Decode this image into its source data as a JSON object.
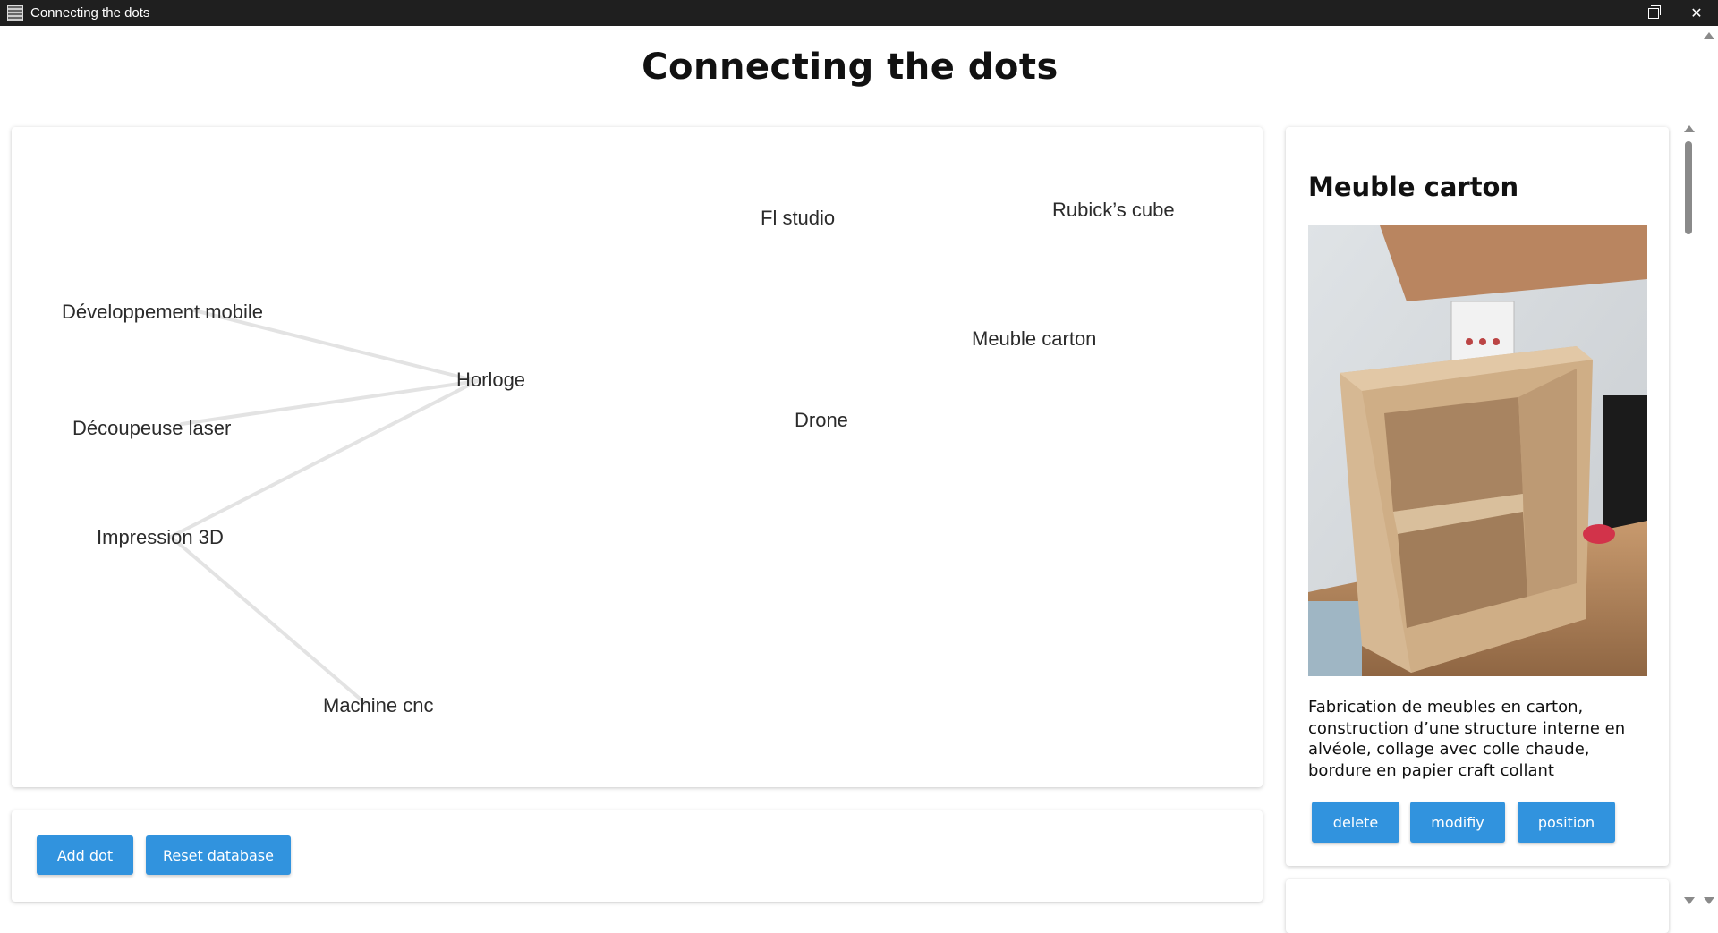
{
  "window": {
    "title": "Connecting the dots"
  },
  "page": {
    "title": "Connecting the dots"
  },
  "graph": {
    "nodes": [
      {
        "id": "fl",
        "label": "Fl studio"
      },
      {
        "id": "rubick",
        "label": "Rubick’s cube"
      },
      {
        "id": "devmobile",
        "label": "Développement mobile"
      },
      {
        "id": "meuble",
        "label": "Meuble carton"
      },
      {
        "id": "horloge",
        "label": "Horloge"
      },
      {
        "id": "drone",
        "label": "Drone"
      },
      {
        "id": "laser",
        "label": "Découpeuse laser"
      },
      {
        "id": "impression",
        "label": "Impression 3D"
      },
      {
        "id": "cnc",
        "label": "Machine cnc"
      }
    ],
    "edges": [
      [
        "devmobile",
        "horloge"
      ],
      [
        "laser",
        "horloge"
      ],
      [
        "impression",
        "horloge"
      ],
      [
        "impression",
        "cnc"
      ]
    ]
  },
  "controls": {
    "add_label": "Add dot",
    "reset_label": "Reset database"
  },
  "detail": {
    "title": "Meuble carton",
    "image_alt": "photo of a cardboard nightstand",
    "description": "Fabrication de meubles en carton, construction d’une structure interne en alvéole, collage avec colle chaude, bordure en papier craft collant",
    "delete_label": "delete",
    "modify_label": "modifiy",
    "position_label": "position"
  },
  "colors": {
    "accent": "#3193de",
    "titlebar": "#1f1f1f",
    "edge": "#e3e3e3"
  }
}
